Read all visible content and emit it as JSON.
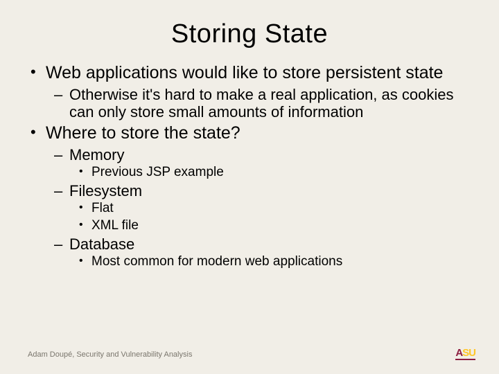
{
  "title": "Storing State",
  "b1": {
    "t": "Web applications would like to store persistent state",
    "s1": "Otherwise it's hard to make a real application, as cookies can only store small amounts of information"
  },
  "b2": {
    "t": "Where to store the state?",
    "s1": {
      "t": "Memory",
      "c1": "Previous JSP example"
    },
    "s2": {
      "t": "Filesystem",
      "c1": "Flat",
      "c2": "XML file"
    },
    "s3": {
      "t": "Database",
      "c1": "Most common for modern web applications"
    }
  },
  "footer": "Adam Doupé, Security and Vulnerability Analysis",
  "logo": {
    "a": "A",
    "su": "SU"
  }
}
